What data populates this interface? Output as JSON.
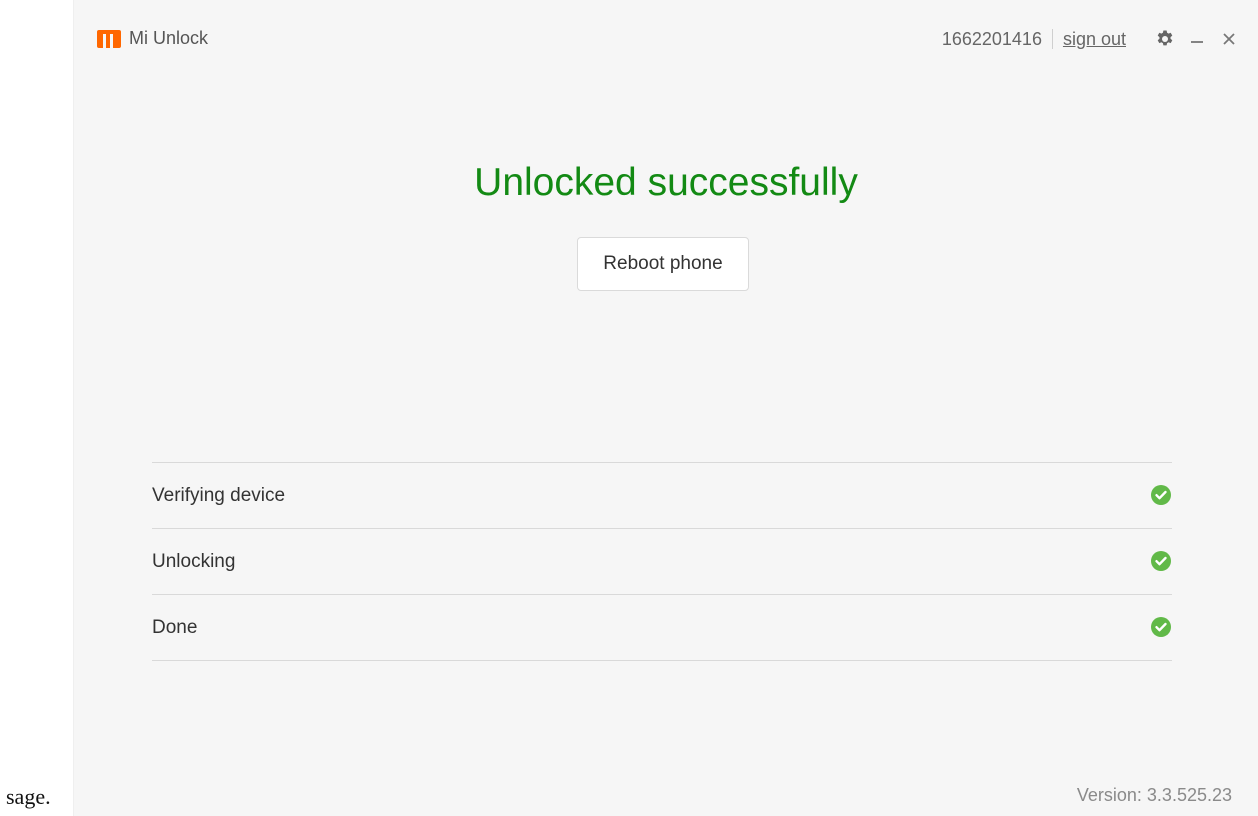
{
  "outside_text": "sage.",
  "app": {
    "title": "Mi Unlock"
  },
  "account": {
    "id": "1662201416",
    "sign_out": "sign out"
  },
  "icons": {
    "settings": "gear-icon",
    "minimize": "minimize-icon",
    "close": "close-icon",
    "status": "checkmark-circle-icon"
  },
  "status": {
    "title": "Unlocked successfully"
  },
  "actions": {
    "reboot": "Reboot phone"
  },
  "steps": [
    {
      "label": "Verifying device",
      "done": true
    },
    {
      "label": "Unlocking",
      "done": true
    },
    {
      "label": "Done",
      "done": true
    }
  ],
  "footer": {
    "version": "Version: 3.3.525.23"
  },
  "colors": {
    "brand": "#ff6700",
    "success": "#138a14",
    "check": "#61b948"
  }
}
